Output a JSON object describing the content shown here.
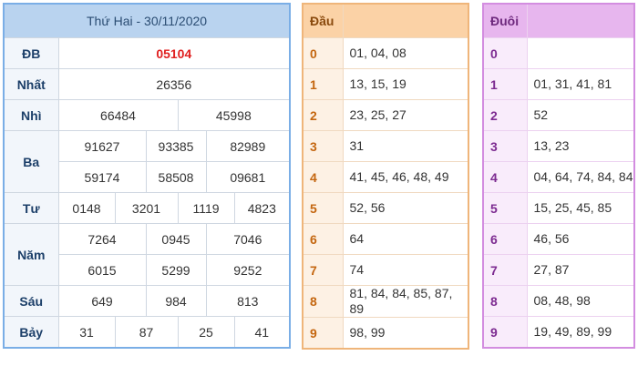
{
  "results": {
    "title": "Thứ Hai - 30/11/2020",
    "rows": {
      "db": {
        "label": "ĐB",
        "values": [
          "05104"
        ]
      },
      "nhat": {
        "label": "Nhất",
        "values": [
          "26356"
        ]
      },
      "nhi": {
        "label": "Nhì",
        "values": [
          "66484",
          "45998"
        ]
      },
      "ba": {
        "label": "Ba",
        "values": [
          "91627",
          "93385",
          "82989",
          "59174",
          "58508",
          "09681"
        ]
      },
      "tu": {
        "label": "Tư",
        "values": [
          "0148",
          "3201",
          "1119",
          "4823"
        ]
      },
      "nam": {
        "label": "Năm",
        "values": [
          "7264",
          "0945",
          "7046",
          "6015",
          "5299",
          "9252"
        ]
      },
      "sau": {
        "label": "Sáu",
        "values": [
          "649",
          "984",
          "813"
        ]
      },
      "bay": {
        "label": "Bảy",
        "values": [
          "31",
          "87",
          "25",
          "41"
        ]
      }
    },
    "colors": {
      "special": "#e02020",
      "header_bg": "#b9d3ef",
      "border": "#7aaee6"
    }
  },
  "dau": {
    "header": "Đầu",
    "rows": [
      {
        "key": "0",
        "value": "01, 04, 08"
      },
      {
        "key": "1",
        "value": "13, 15, 19"
      },
      {
        "key": "2",
        "value": "23, 25, 27"
      },
      {
        "key": "3",
        "value": "31"
      },
      {
        "key": "4",
        "value": "41, 45, 46, 48, 49"
      },
      {
        "key": "5",
        "value": "52, 56"
      },
      {
        "key": "6",
        "value": "64"
      },
      {
        "key": "7",
        "value": "74"
      },
      {
        "key": "8",
        "value": "81, 84, 84, 85, 87, 89"
      },
      {
        "key": "9",
        "value": "98, 99"
      }
    ],
    "colors": {
      "header_bg": "#fbd2a6",
      "border": "#efb57a"
    }
  },
  "duoi": {
    "header": "Đuôi",
    "rows": [
      {
        "key": "0",
        "value": ""
      },
      {
        "key": "1",
        "value": "01, 31, 41, 81"
      },
      {
        "key": "2",
        "value": "52"
      },
      {
        "key": "3",
        "value": "13, 23"
      },
      {
        "key": "4",
        "value": "04, 64, 74, 84, 84"
      },
      {
        "key": "5",
        "value": "15, 25, 45, 85"
      },
      {
        "key": "6",
        "value": "46, 56"
      },
      {
        "key": "7",
        "value": "27, 87"
      },
      {
        "key": "8",
        "value": "08, 48, 98"
      },
      {
        "key": "9",
        "value": "19, 49, 89, 99"
      }
    ],
    "colors": {
      "header_bg": "#e7b6ee",
      "border": "#d38de0"
    }
  }
}
